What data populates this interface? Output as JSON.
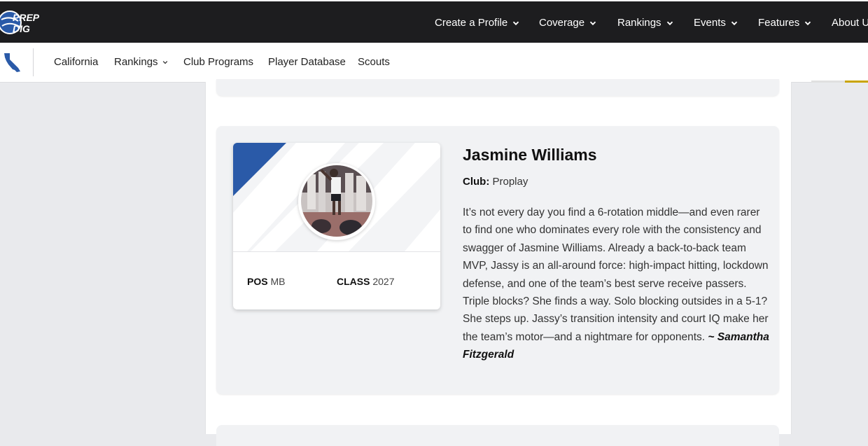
{
  "brand": {
    "logo_line1": "PREP",
    "logo_line2": "DIG"
  },
  "topnav": {
    "items": [
      {
        "label": "Create a Profile"
      },
      {
        "label": "Coverage"
      },
      {
        "label": "Rankings"
      },
      {
        "label": "Events"
      },
      {
        "label": "Features"
      },
      {
        "label": "About U"
      }
    ]
  },
  "subnav": {
    "items": [
      {
        "label": "California"
      },
      {
        "label": "Rankings"
      },
      {
        "label": "Club Programs"
      },
      {
        "label": "Player Database"
      },
      {
        "label": "Scouts"
      }
    ]
  },
  "player": {
    "name": "Jasmine Williams",
    "club_label": "Club:",
    "club_value": "Proplay",
    "pos_label": "POS",
    "pos_value": "MB",
    "class_label": "CLASS",
    "class_value": "2027",
    "bio": "It’s not every day you find a 6-rotation middle—and even rarer to find one who dominates every role with the consistency and swagger of Jasmine Williams. Already a back-to-back team MVP, Jassy is an all-around force: high-impact hitting, lockdown defense, and one of the team’s best serve receive passers. Triple blocks? She finds a way. Solo blocking outsides in a 5-1? She steps up. Jassy’s transition intensity and court IQ make her the team’s motor—and a nightmare for opponents.",
    "author": "~ Samantha Fitzgerald"
  },
  "colors": {
    "accent": "#2a5aa8",
    "nav_bg": "#1d1d1f"
  }
}
